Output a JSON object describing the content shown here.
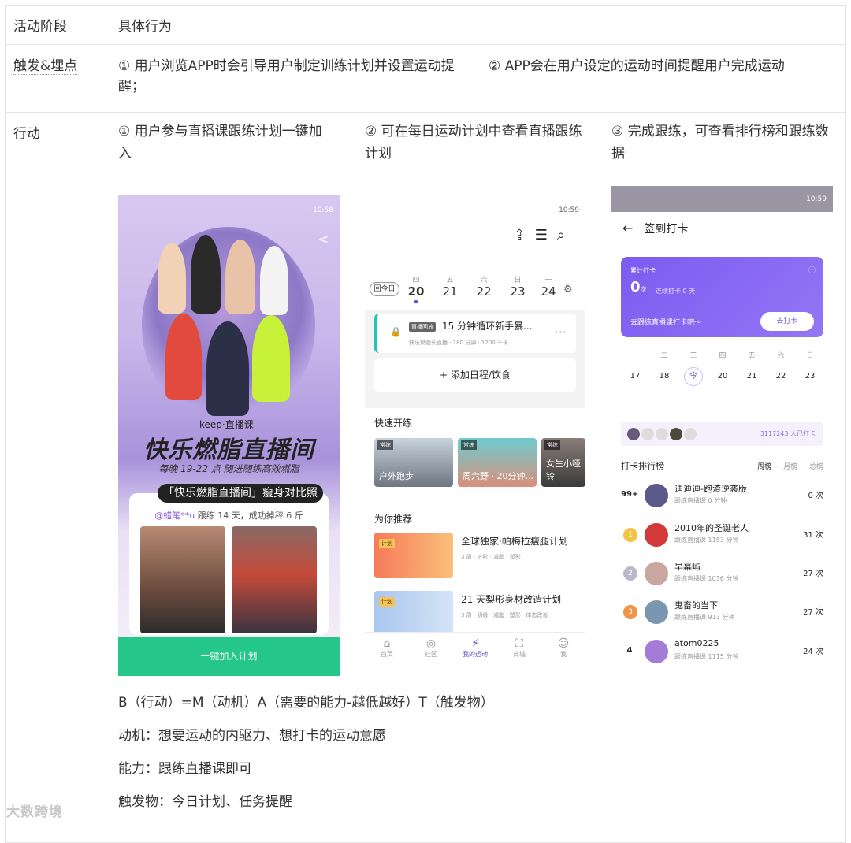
{
  "table": {
    "header": {
      "stage": "活动阶段",
      "behavior": "具体行为"
    },
    "trigger": {
      "label": "触发&埋点",
      "item1": "① 用户浏览APP时会引导用户制定训练计划并设置运动提醒；",
      "item2": "② APP会在用户设定的运动时间提醒用户完成运动"
    },
    "action": {
      "label": "行动",
      "col1_title": "① 用户参与直播课跟练计划一键加入",
      "col2_title": "② 可在每日运动计划中查看直播跟练计划",
      "col3_title": "③ 完成跟练，可查看排行榜和跟练数据"
    },
    "formula": {
      "line1": "B（行动）=M（动机）A（需要的能力-越低越好）T（触发物）",
      "line2": "动机：想要运动的内驱力、想打卡的运动意愿",
      "line3": "能力：跟练直播课即可",
      "line4": "触发物：今日计划、任务提醒"
    }
  },
  "phone1": {
    "status": "10:58",
    "keep": "keep·直播课",
    "headline": "快乐燃脂直播间",
    "subline": "每晚 19-22 点 随进随练高效燃脂",
    "card_tag": "「快乐燃脂直播间」瘦身对比照",
    "user": "@蜡笔**u",
    "user_text": "跟练 14 天，成功掉秤 6 斤",
    "button": "一键加入计划"
  },
  "phone2": {
    "status": "10:59",
    "today": "回今日",
    "days": [
      {
        "wd": "四",
        "dn": "20"
      },
      {
        "wd": "五",
        "dn": "21"
      },
      {
        "wd": "六",
        "dn": "22"
      },
      {
        "wd": "日",
        "dn": "23"
      },
      {
        "wd": "一",
        "dn": "24"
      }
    ],
    "plan_tag": "直播回放",
    "plan_name": "15 分钟循环新手暴...",
    "plan_meta": "快乐燃脂长直播 · 180 分钟 · 1200 千卡",
    "add": "+ 添加日程/饮食",
    "quick_title": "快速开练",
    "quick": [
      {
        "tag": "常练",
        "cap": "户外跑步"
      },
      {
        "tag": "常练",
        "cap": "周六野 · 20分钟..."
      },
      {
        "tag": "常练",
        "cap": "女生小哑铃"
      }
    ],
    "rec_title": "为你推荐",
    "recs": [
      {
        "tag": "计划",
        "title": "全球独家·帕梅拉瘦腿计划",
        "meta": "3 周 · 进阶 · 减脂 · 塑形"
      },
      {
        "tag": "计划",
        "title": "21 天梨形身材改造计划",
        "meta": "3 周 · 初级 · 减脂 · 塑形 · 体态改善"
      }
    ],
    "tabs": [
      "首页",
      "社区",
      "我的运动",
      "商城",
      "我"
    ]
  },
  "phone3": {
    "status": "10:59",
    "title": "签到打卡",
    "banner_label": "累计打卡",
    "banner_num": "0",
    "banner_unit": "次",
    "banner_cont": "连续打卡 0 天",
    "banner_go": "去跟练直播课打卡吧～",
    "banner_btn": "去打卡",
    "weekdays": [
      "一",
      "二",
      "三",
      "四",
      "五",
      "六",
      "日"
    ],
    "dates": [
      "17",
      "18",
      "今",
      "20",
      "21",
      "22",
      "23"
    ],
    "strip_count": "3117243 人已打卡",
    "rank_title": "打卡排行榜",
    "rank_tabs": {
      "week": "周榜",
      "month": "月榜",
      "total": "总榜"
    },
    "ranks": [
      {
        "rank": "99+",
        "name": "迪迪迪-跑渣逆袭版",
        "sub": "跟练直播课 0 分钟",
        "count": "0 次",
        "color": "#5a5a8a"
      },
      {
        "rank": "1",
        "name": "2010年的圣诞老人",
        "sub": "跟练直播课 1153 分钟",
        "count": "31 次",
        "color": "#f3c343"
      },
      {
        "rank": "2",
        "name": "早幕屿",
        "sub": "跟练直播课 1036 分钟",
        "count": "27 次",
        "color": "#b9b9c9"
      },
      {
        "rank": "3",
        "name": "鬼畜的当下",
        "sub": "跟练直播课 913 分钟",
        "count": "27 次",
        "color": "#f0954a"
      },
      {
        "rank": "4",
        "name": "atom0225",
        "sub": "跟练直播课 1115 分钟",
        "count": "24 次",
        "color": "#a47cd8"
      }
    ]
  },
  "watermark": "大数跨境"
}
